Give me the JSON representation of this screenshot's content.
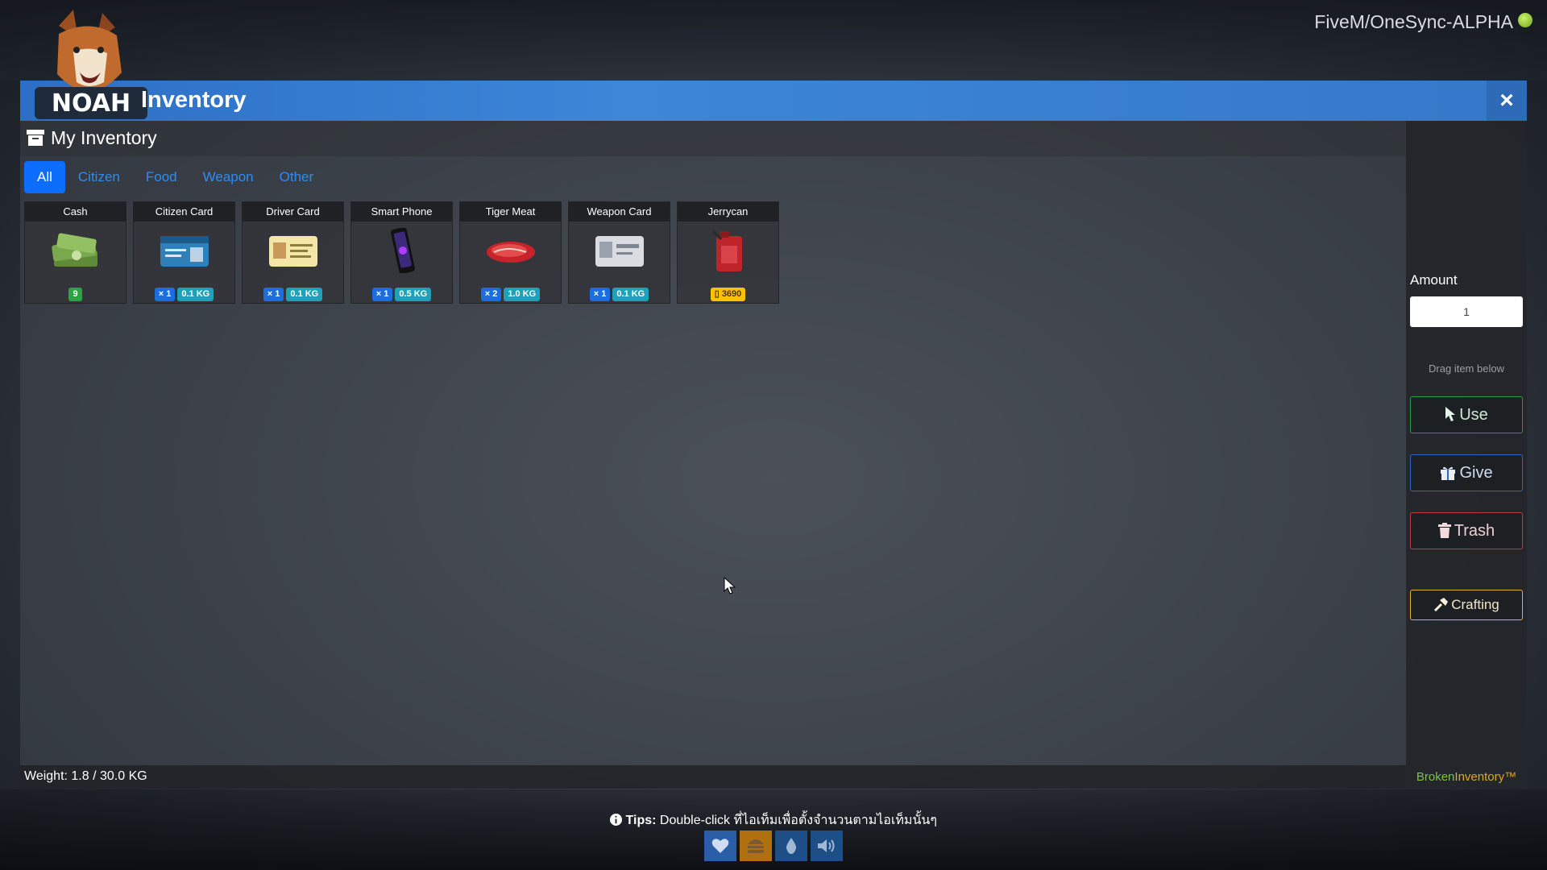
{
  "server": {
    "name": "FiveM/OneSync-ALPHA"
  },
  "window": {
    "title": "Inventory",
    "close_icon": "×"
  },
  "inventory": {
    "header": "My Inventory",
    "tabs": [
      {
        "label": "All",
        "active": true
      },
      {
        "label": "Citizen",
        "active": false
      },
      {
        "label": "Food",
        "active": false
      },
      {
        "label": "Weapon",
        "active": false
      },
      {
        "label": "Other",
        "active": false
      }
    ],
    "items": [
      {
        "name": "Cash",
        "icon": "cash-icon",
        "badges": [
          {
            "text": "9",
            "style": "green"
          }
        ]
      },
      {
        "name": "Citizen Card",
        "icon": "citizen-card-icon",
        "badges": [
          {
            "text": "× 1",
            "style": "qty"
          },
          {
            "text": "0.1 KG",
            "style": "wt"
          }
        ]
      },
      {
        "name": "Driver Card",
        "icon": "driver-card-icon",
        "badges": [
          {
            "text": "× 1",
            "style": "qty"
          },
          {
            "text": "0.1 KG",
            "style": "wt"
          }
        ]
      },
      {
        "name": "Smart Phone",
        "icon": "phone-icon",
        "badges": [
          {
            "text": "× 1",
            "style": "qty"
          },
          {
            "text": "0.5 KG",
            "style": "wt"
          }
        ]
      },
      {
        "name": "Tiger Meat",
        "icon": "meat-icon",
        "badges": [
          {
            "text": "× 2",
            "style": "qty"
          },
          {
            "text": "1.0 KG",
            "style": "wt"
          }
        ]
      },
      {
        "name": "Weapon Card",
        "icon": "weapon-card-icon",
        "badges": [
          {
            "text": "× 1",
            "style": "qty"
          },
          {
            "text": "0.1 KG",
            "style": "wt"
          }
        ]
      },
      {
        "name": "Jerrycan",
        "icon": "jerrycan-icon",
        "badges": [
          {
            "text": "▯ 3690",
            "style": "yellow"
          }
        ]
      }
    ],
    "weight_text": "Weight: 1.8 / 30.0 KG"
  },
  "sidebar": {
    "amount_label": "Amount",
    "amount_value": "1",
    "drag_hint": "Drag item below",
    "use_label": "Use",
    "give_label": "Give",
    "trash_label": "Trash",
    "crafting_label": "Crafting",
    "brand_part1": "Broken",
    "brand_part2": "Inventory™"
  },
  "tips": {
    "label": "Tips:",
    "text": " Double-click ที่ไอเท็มเพื่อตั้งจำนวนตามไอเท็มนั้นๆ"
  },
  "status_icons": [
    "heart-icon",
    "burger-icon",
    "water-drop-icon",
    "speaker-icon"
  ],
  "colors": {
    "titlebar": "#3d86d8",
    "tab_active": "#0d6efd",
    "use": "#2f9a4a",
    "give": "#2a6bbf",
    "trash": "#c23a44",
    "crafting": "#e0b32a"
  }
}
